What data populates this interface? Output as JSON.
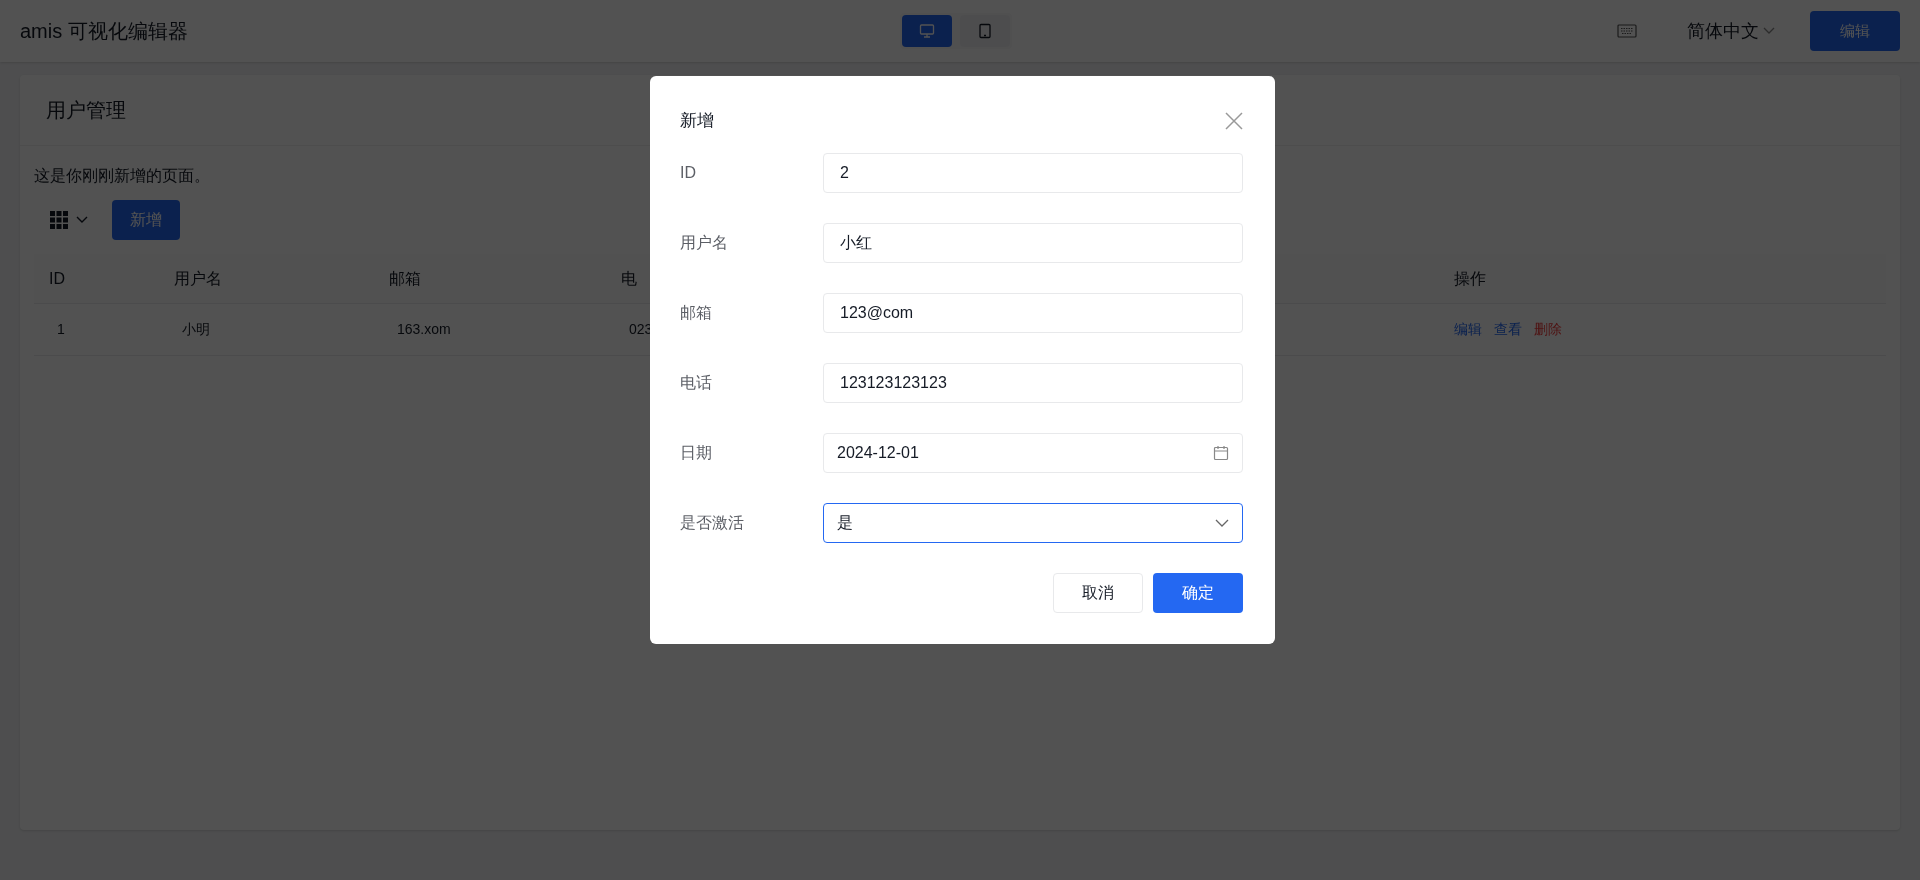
{
  "header": {
    "title": "amis 可视化编辑器",
    "devices": [
      {
        "kind": "desktop",
        "selected": true
      },
      {
        "kind": "tablet",
        "selected": false
      }
    ],
    "language": "简体中文",
    "edit_button": "编辑"
  },
  "page": {
    "title": "用户管理",
    "description": "这是你刚刚新增的页面。",
    "add_button": "新增",
    "table": {
      "columns": [
        "ID",
        "用户名",
        "邮箱",
        "电",
        "操作"
      ],
      "rows": [
        {
          "cells": [
            "1",
            "小明",
            "163.xom",
            "023"
          ],
          "actions": [
            {
              "label": "编辑",
              "kind": "normal"
            },
            {
              "label": "查看",
              "kind": "normal"
            },
            {
              "label": "删除",
              "kind": "danger"
            }
          ]
        }
      ]
    }
  },
  "dialog": {
    "title": "新增",
    "fields": [
      {
        "label": "ID",
        "value": "2",
        "kind": "text"
      },
      {
        "label": "用户名",
        "value": "小红",
        "kind": "text"
      },
      {
        "label": "邮箱",
        "value": "123@com",
        "kind": "text"
      },
      {
        "label": "电话",
        "value": "123123123123",
        "kind": "text"
      },
      {
        "label": "日期",
        "value": "2024-12-01",
        "kind": "date"
      },
      {
        "label": "是否激活",
        "value": "是",
        "kind": "select"
      }
    ],
    "buttons": [
      {
        "label": "取消",
        "kind": "default"
      },
      {
        "label": "确定",
        "kind": "primary"
      }
    ]
  }
}
